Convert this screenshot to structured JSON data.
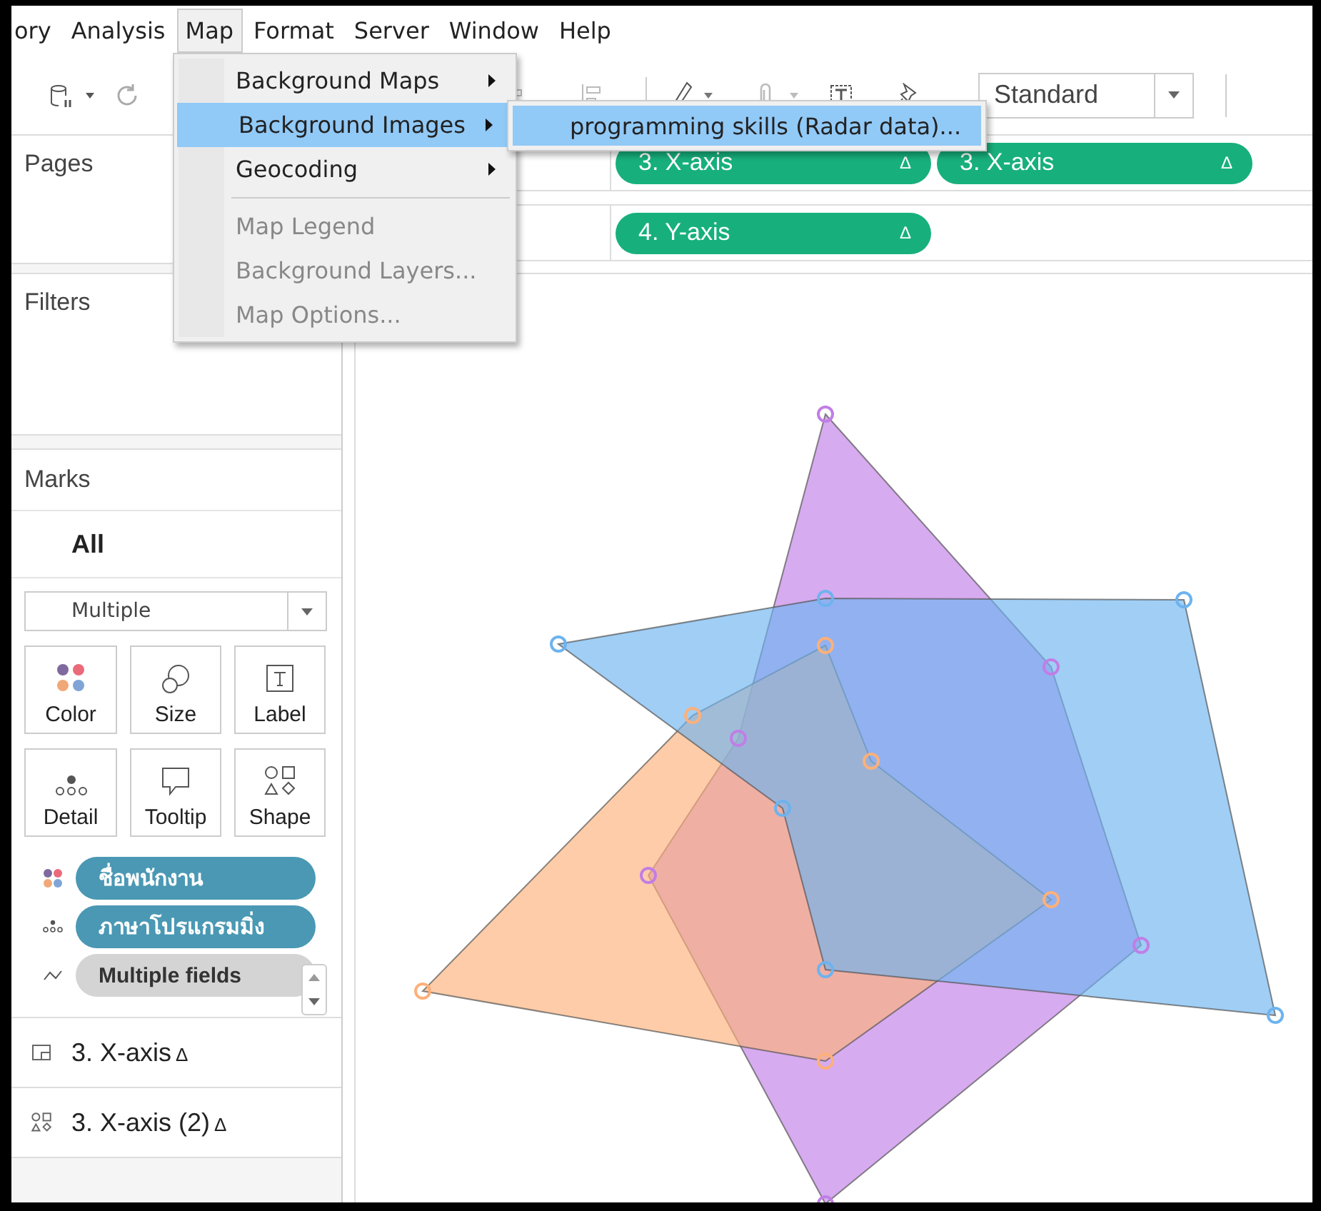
{
  "menu_bar": [
    {
      "label": "ory",
      "selected": false
    },
    {
      "label": "Analysis",
      "selected": false
    },
    {
      "label": "Map",
      "selected": true
    },
    {
      "label": "Format",
      "selected": false
    },
    {
      "label": "Server",
      "selected": false
    },
    {
      "label": "Window",
      "selected": false
    },
    {
      "label": "Help",
      "selected": false
    }
  ],
  "map_menu": [
    {
      "label": "Background Maps",
      "submenu": true,
      "disabled": false,
      "selected": false,
      "separator_after": false
    },
    {
      "label": "Background Images",
      "submenu": true,
      "disabled": false,
      "selected": true,
      "separator_after": false
    },
    {
      "label": "Geocoding",
      "submenu": true,
      "disabled": false,
      "selected": false,
      "separator_after": true
    },
    {
      "label": "Map Legend",
      "submenu": false,
      "disabled": true,
      "selected": false,
      "separator_after": false
    },
    {
      "label": "Background Layers...",
      "submenu": false,
      "disabled": true,
      "selected": false,
      "separator_after": false
    },
    {
      "label": "Map Options...",
      "submenu": false,
      "disabled": true,
      "selected": false,
      "separator_after": false
    }
  ],
  "submenu": [
    {
      "label": "programming skills (Radar data)...",
      "selected": true
    }
  ],
  "toolbar": {
    "fit_dropdown": "Standard"
  },
  "columns_shelf": [
    {
      "label": "3. X-axis",
      "flag": "Δ"
    },
    {
      "label": "3. X-axis",
      "flag": "Δ"
    }
  ],
  "rows_shelf": [
    {
      "label": "4. Y-axis",
      "flag": "Δ"
    }
  ],
  "pages": {
    "title": "Pages"
  },
  "filters": {
    "title": "Filters"
  },
  "marks": {
    "title": "Marks",
    "layer": "All",
    "mark_type": "Multiple",
    "cards": [
      {
        "label": "Color",
        "kind": "color"
      },
      {
        "label": "Size",
        "kind": "size"
      },
      {
        "label": "Label",
        "kind": "label"
      },
      {
        "label": "Detail",
        "kind": "detail"
      },
      {
        "label": "Tooltip",
        "kind": "tooltip"
      },
      {
        "label": "Shape",
        "kind": "shape"
      }
    ],
    "fields": [
      {
        "label": "ชื่อพนักงาน",
        "kind": "color",
        "color": "#4a98b4"
      },
      {
        "label": "ภาษาโปรแกรมมิ่ง",
        "kind": "detail",
        "color": "#4a98b4"
      },
      {
        "label": "Multiple fields",
        "kind": "path",
        "color": "#d4d4d4"
      }
    ],
    "layers": [
      {
        "label": "3. X-axis",
        "flag": "Δ",
        "kind": "polygon"
      },
      {
        "label": "3. X-axis (2)",
        "flag": "Δ",
        "kind": "shape"
      }
    ]
  },
  "chart": {
    "series": [
      {
        "color": "#c17ee6"
      },
      {
        "color": "#fdb07a"
      },
      {
        "color": "#6db3ef"
      }
    ]
  }
}
